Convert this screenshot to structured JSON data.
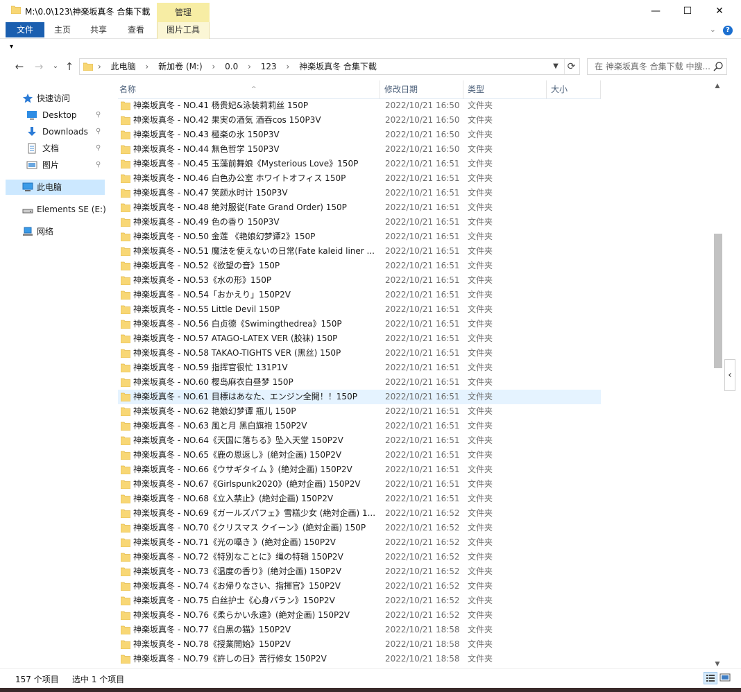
{
  "window": {
    "title": "M:\\0.0\\123\\神楽坂真冬 合集下載",
    "context_tab": "管理",
    "minimize_glyph": "—",
    "maximize_glyph": "☐",
    "close_glyph": "✕"
  },
  "ribbon": {
    "tabs": [
      "文件",
      "主页",
      "共享",
      "查看",
      "图片工具"
    ],
    "expand_glyph": "⌄",
    "help_glyph": "?"
  },
  "qat": {
    "glyph": "▾"
  },
  "address": {
    "crumbs": [
      "此电脑",
      "新加卷 (M:)",
      "0.0",
      "123",
      "神楽坂真冬 合集下載"
    ],
    "separator": "›",
    "search_placeholder": "在 神楽坂真冬 合集下载 中搜..."
  },
  "nav": {
    "back": "←",
    "forward": "→",
    "recent": "⌄",
    "up": "↑",
    "items": [
      {
        "label": "快速访问",
        "icon": "star-icon"
      },
      {
        "label": "Desktop",
        "icon": "desktop-icon",
        "pinned": true
      },
      {
        "label": "Downloads",
        "icon": "download-icon",
        "pinned": true
      },
      {
        "label": "文档",
        "icon": "document-icon",
        "pinned": true
      },
      {
        "label": "图片",
        "icon": "picture-icon",
        "pinned": true
      },
      {
        "label": "此电脑",
        "icon": "computer-icon",
        "selected": true
      },
      {
        "label": "Elements SE (E:)",
        "icon": "drive-icon"
      },
      {
        "label": "网络",
        "icon": "network-icon"
      }
    ],
    "pin_glyph": "📌"
  },
  "columns": {
    "name": "名称",
    "date": "修改日期",
    "type": "类型",
    "size": "大小"
  },
  "files": [
    {
      "name": "神楽坂真冬 - NO.41 杨贵妃&泳装莉莉丝 150P",
      "date": "2022/10/21 16:50",
      "type": "文件夹"
    },
    {
      "name": "神楽坂真冬 - NO.42 果実の酒気 酒吞cos 150P3V",
      "date": "2022/10/21 16:50",
      "type": "文件夹"
    },
    {
      "name": "神楽坂真冬 - NO.43 極楽の氷 150P3V",
      "date": "2022/10/21 16:50",
      "type": "文件夹"
    },
    {
      "name": "神楽坂真冬 - NO.44 無色哲学 150P3V",
      "date": "2022/10/21 16:50",
      "type": "文件夹"
    },
    {
      "name": "神楽坂真冬 - NO.45 玉藻前舞娘《Mysterious Love》150P",
      "date": "2022/10/21 16:51",
      "type": "文件夹"
    },
    {
      "name": "神楽坂真冬 - NO.46 白色办公室 ホワイトオフィス 150P",
      "date": "2022/10/21 16:51",
      "type": "文件夹"
    },
    {
      "name": "神楽坂真冬 - NO.47 笑颜水时计 150P3V",
      "date": "2022/10/21 16:51",
      "type": "文件夹"
    },
    {
      "name": "神楽坂真冬 - NO.48 絶対服従(Fate Grand Order) 150P",
      "date": "2022/10/21 16:51",
      "type": "文件夹"
    },
    {
      "name": "神楽坂真冬 - NO.49 色の香り 150P3V",
      "date": "2022/10/21 16:51",
      "type": "文件夹"
    },
    {
      "name": "神楽坂真冬 - NO.50 金莲 《艳娘幻梦谭2》150P",
      "date": "2022/10/21 16:51",
      "type": "文件夹"
    },
    {
      "name": "神楽坂真冬 - NO.51 魔法を使えないの日常(Fate kaleid liner ...",
      "date": "2022/10/21 16:51",
      "type": "文件夹"
    },
    {
      "name": "神楽坂真冬 - NO.52《欲望の音》150P",
      "date": "2022/10/21 16:51",
      "type": "文件夹"
    },
    {
      "name": "神楽坂真冬 - NO.53《水の形》150P",
      "date": "2022/10/21 16:51",
      "type": "文件夹"
    },
    {
      "name": "神楽坂真冬 - NO.54「おかえり」150P2V",
      "date": "2022/10/21 16:51",
      "type": "文件夹"
    },
    {
      "name": "神楽坂真冬 - NO.55 Little Devil 150P",
      "date": "2022/10/21 16:51",
      "type": "文件夹"
    },
    {
      "name": "神楽坂真冬 - NO.56 白贞德《Swimingthedrea》150P",
      "date": "2022/10/21 16:51",
      "type": "文件夹"
    },
    {
      "name": "神楽坂真冬 - NO.57 ATAGO-LATEX VER (胶袜) 150P",
      "date": "2022/10/21 16:51",
      "type": "文件夹"
    },
    {
      "name": "神楽坂真冬 - NO.58 TAKAO-TIGHTS VER (黑丝) 150P",
      "date": "2022/10/21 16:51",
      "type": "文件夹"
    },
    {
      "name": "神楽坂真冬 - NO.59 指挥官很忙 131P1V",
      "date": "2022/10/21 16:51",
      "type": "文件夹"
    },
    {
      "name": "神楽坂真冬 - NO.60 樱岛麻衣白昼梦 150P",
      "date": "2022/10/21 16:51",
      "type": "文件夹"
    },
    {
      "name": "神楽坂真冬 - NO.61 目標はあなた、エンジン全開！！150P",
      "date": "2022/10/21 16:51",
      "type": "文件夹",
      "selected": true
    },
    {
      "name": "神楽坂真冬 - NO.62 艳娘幻梦谭 瓶儿 150P",
      "date": "2022/10/21 16:51",
      "type": "文件夹"
    },
    {
      "name": "神楽坂真冬 - NO.63 風と月 黑白旗袍 150P2V",
      "date": "2022/10/21 16:51",
      "type": "文件夹"
    },
    {
      "name": "神楽坂真冬 - NO.64《天国に落ちる》坠入天堂 150P2V",
      "date": "2022/10/21 16:51",
      "type": "文件夹"
    },
    {
      "name": "神楽坂真冬 - NO.65《鹿の恩返し》(絶対企画) 150P2V",
      "date": "2022/10/21 16:51",
      "type": "文件夹"
    },
    {
      "name": "神楽坂真冬 - NO.66《ウサギタイム 》(絶対企画) 150P2V",
      "date": "2022/10/21 16:51",
      "type": "文件夹"
    },
    {
      "name": "神楽坂真冬 - NO.67《Girlspunk2020》(絶対企画) 150P2V",
      "date": "2022/10/21 16:51",
      "type": "文件夹"
    },
    {
      "name": "神楽坂真冬 - NO.68《立入禁止》(絶対企画) 150P2V",
      "date": "2022/10/21 16:51",
      "type": "文件夹"
    },
    {
      "name": "神楽坂真冬 - NO.69《ガールズパフェ》雪糕少女 (絶対企画) 1...",
      "date": "2022/10/21 16:52",
      "type": "文件夹"
    },
    {
      "name": "神楽坂真冬 - NO.70《クリスマス クイーン》(絶対企画) 150P",
      "date": "2022/10/21 16:52",
      "type": "文件夹"
    },
    {
      "name": "神楽坂真冬 - NO.71《光の囁き 》(絶対企画) 150P2V",
      "date": "2022/10/21 16:52",
      "type": "文件夹"
    },
    {
      "name": "神楽坂真冬 - NO.72《特別なことに》绳の特辑 150P2V",
      "date": "2022/10/21 16:52",
      "type": "文件夹"
    },
    {
      "name": "神楽坂真冬 - NO.73《温度の香り》(絶対企画) 150P2V",
      "date": "2022/10/21 16:52",
      "type": "文件夹"
    },
    {
      "name": "神楽坂真冬 - NO.74《お帰りなさい、指揮官》150P2V",
      "date": "2022/10/21 16:52",
      "type": "文件夹"
    },
    {
      "name": "神楽坂真冬 - NO.75 白丝护士《心身バラン》150P2V",
      "date": "2022/10/21 16:52",
      "type": "文件夹"
    },
    {
      "name": "神楽坂真冬 - NO.76《柔らかい永遠》(絶対企画) 150P2V",
      "date": "2022/10/21 16:52",
      "type": "文件夹"
    },
    {
      "name": "神楽坂真冬 - NO.77《白黒の猫》150P2V",
      "date": "2022/10/21 18:58",
      "type": "文件夹"
    },
    {
      "name": "神楽坂真冬 - NO.78《授業開始》150P2V",
      "date": "2022/10/21 18:58",
      "type": "文件夹"
    },
    {
      "name": "神楽坂真冬 - NO.79《許しの日》苦行修女 150P2V",
      "date": "2022/10/21 18:58",
      "type": "文件夹"
    }
  ],
  "scrollbar": {
    "up": "▲",
    "down": "▼",
    "collapse_glyph": "‹",
    "thumb_start": 0.25,
    "thumb_end": 0.49
  },
  "status": {
    "count": "157 个项目",
    "selection": "选中 1 个项目"
  },
  "colors": {
    "folder": "#f8d775",
    "folder_dark": "#e2b94a",
    "selection": "#cce8ff",
    "row_selection": "#e5f3ff",
    "file_tab": "#1b5fb0",
    "context_tab": "#f7eda4"
  }
}
